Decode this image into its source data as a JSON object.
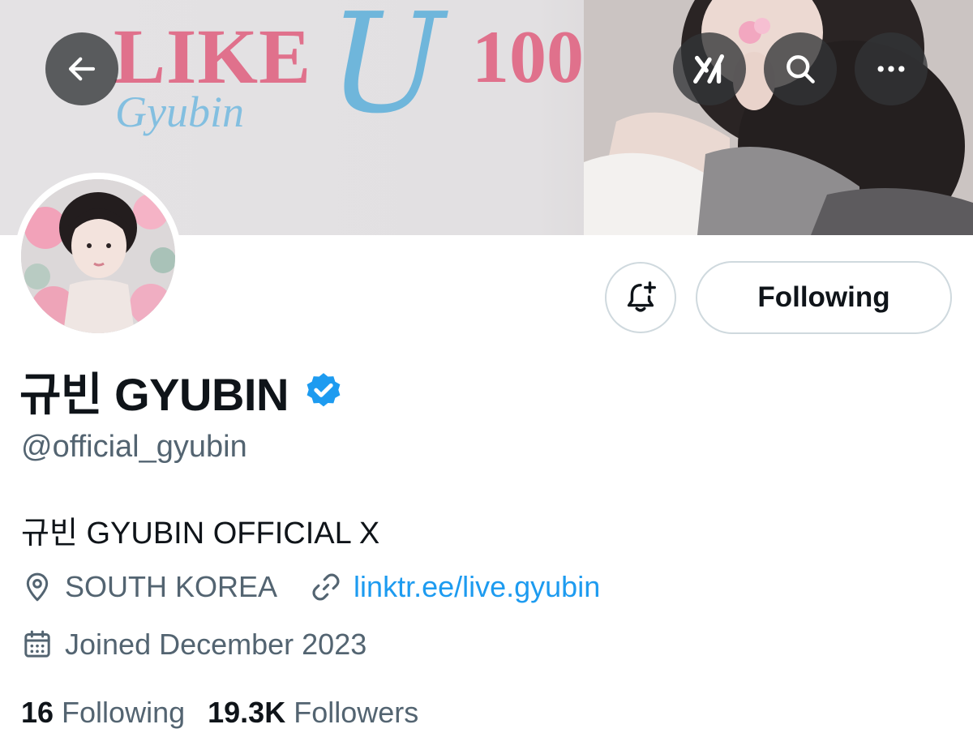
{
  "banner": {
    "like": "LIKE",
    "gyubin": "Gyubin",
    "u": "U",
    "hundred": "100"
  },
  "profile": {
    "display_name": "규빈 GYUBIN",
    "handle": "@official_gyubin",
    "bio": "규빈 GYUBIN OFFICIAL X",
    "location": "SOUTH KOREA",
    "link": "linktr.ee/live.gyubin",
    "joined": "Joined December 2023"
  },
  "actions": {
    "following_label": "Following"
  },
  "stats": {
    "following_count": "16",
    "following_label": "Following",
    "followers_count": "19.3K",
    "followers_label": "Followers"
  },
  "icons": {
    "back": "arrow-left-icon",
    "grok": "grok-icon",
    "search": "search-icon",
    "more": "more-icon",
    "notify": "bell-plus-icon",
    "verified": "verified-badge-icon",
    "location": "location-pin-icon",
    "link": "link-icon",
    "calendar": "calendar-icon"
  },
  "colors": {
    "accent": "#1d9bf0",
    "secondary_text": "#536471",
    "primary_text": "#0f1419",
    "border": "#cfd9de"
  }
}
